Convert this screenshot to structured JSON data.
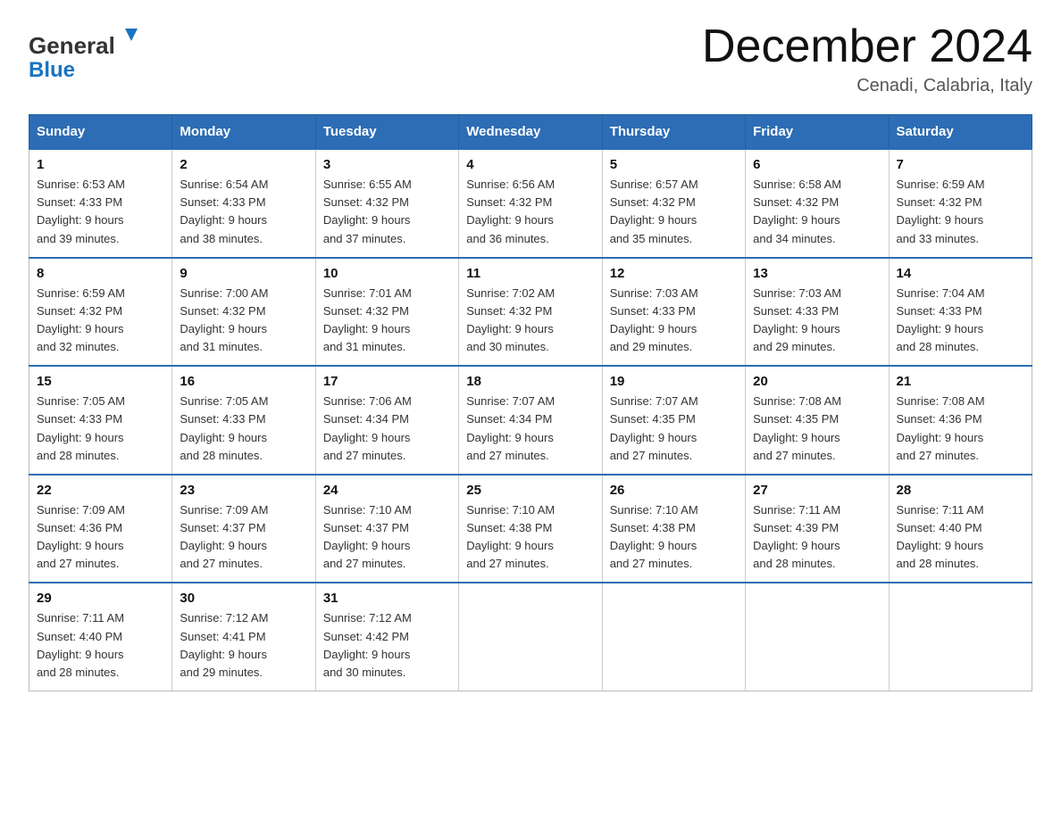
{
  "header": {
    "logo_general": "General",
    "logo_blue": "Blue",
    "month_title": "December 2024",
    "location": "Cenadi, Calabria, Italy"
  },
  "days_of_week": [
    "Sunday",
    "Monday",
    "Tuesday",
    "Wednesday",
    "Thursday",
    "Friday",
    "Saturday"
  ],
  "weeks": [
    [
      {
        "day": "1",
        "sunrise": "6:53 AM",
        "sunset": "4:33 PM",
        "daylight": "9 hours and 39 minutes."
      },
      {
        "day": "2",
        "sunrise": "6:54 AM",
        "sunset": "4:33 PM",
        "daylight": "9 hours and 38 minutes."
      },
      {
        "day": "3",
        "sunrise": "6:55 AM",
        "sunset": "4:32 PM",
        "daylight": "9 hours and 37 minutes."
      },
      {
        "day": "4",
        "sunrise": "6:56 AM",
        "sunset": "4:32 PM",
        "daylight": "9 hours and 36 minutes."
      },
      {
        "day": "5",
        "sunrise": "6:57 AM",
        "sunset": "4:32 PM",
        "daylight": "9 hours and 35 minutes."
      },
      {
        "day": "6",
        "sunrise": "6:58 AM",
        "sunset": "4:32 PM",
        "daylight": "9 hours and 34 minutes."
      },
      {
        "day": "7",
        "sunrise": "6:59 AM",
        "sunset": "4:32 PM",
        "daylight": "9 hours and 33 minutes."
      }
    ],
    [
      {
        "day": "8",
        "sunrise": "6:59 AM",
        "sunset": "4:32 PM",
        "daylight": "9 hours and 32 minutes."
      },
      {
        "day": "9",
        "sunrise": "7:00 AM",
        "sunset": "4:32 PM",
        "daylight": "9 hours and 31 minutes."
      },
      {
        "day": "10",
        "sunrise": "7:01 AM",
        "sunset": "4:32 PM",
        "daylight": "9 hours and 31 minutes."
      },
      {
        "day": "11",
        "sunrise": "7:02 AM",
        "sunset": "4:32 PM",
        "daylight": "9 hours and 30 minutes."
      },
      {
        "day": "12",
        "sunrise": "7:03 AM",
        "sunset": "4:33 PM",
        "daylight": "9 hours and 29 minutes."
      },
      {
        "day": "13",
        "sunrise": "7:03 AM",
        "sunset": "4:33 PM",
        "daylight": "9 hours and 29 minutes."
      },
      {
        "day": "14",
        "sunrise": "7:04 AM",
        "sunset": "4:33 PM",
        "daylight": "9 hours and 28 minutes."
      }
    ],
    [
      {
        "day": "15",
        "sunrise": "7:05 AM",
        "sunset": "4:33 PM",
        "daylight": "9 hours and 28 minutes."
      },
      {
        "day": "16",
        "sunrise": "7:05 AM",
        "sunset": "4:33 PM",
        "daylight": "9 hours and 28 minutes."
      },
      {
        "day": "17",
        "sunrise": "7:06 AM",
        "sunset": "4:34 PM",
        "daylight": "9 hours and 27 minutes."
      },
      {
        "day": "18",
        "sunrise": "7:07 AM",
        "sunset": "4:34 PM",
        "daylight": "9 hours and 27 minutes."
      },
      {
        "day": "19",
        "sunrise": "7:07 AM",
        "sunset": "4:35 PM",
        "daylight": "9 hours and 27 minutes."
      },
      {
        "day": "20",
        "sunrise": "7:08 AM",
        "sunset": "4:35 PM",
        "daylight": "9 hours and 27 minutes."
      },
      {
        "day": "21",
        "sunrise": "7:08 AM",
        "sunset": "4:36 PM",
        "daylight": "9 hours and 27 minutes."
      }
    ],
    [
      {
        "day": "22",
        "sunrise": "7:09 AM",
        "sunset": "4:36 PM",
        "daylight": "9 hours and 27 minutes."
      },
      {
        "day": "23",
        "sunrise": "7:09 AM",
        "sunset": "4:37 PM",
        "daylight": "9 hours and 27 minutes."
      },
      {
        "day": "24",
        "sunrise": "7:10 AM",
        "sunset": "4:37 PM",
        "daylight": "9 hours and 27 minutes."
      },
      {
        "day": "25",
        "sunrise": "7:10 AM",
        "sunset": "4:38 PM",
        "daylight": "9 hours and 27 minutes."
      },
      {
        "day": "26",
        "sunrise": "7:10 AM",
        "sunset": "4:38 PM",
        "daylight": "9 hours and 27 minutes."
      },
      {
        "day": "27",
        "sunrise": "7:11 AM",
        "sunset": "4:39 PM",
        "daylight": "9 hours and 28 minutes."
      },
      {
        "day": "28",
        "sunrise": "7:11 AM",
        "sunset": "4:40 PM",
        "daylight": "9 hours and 28 minutes."
      }
    ],
    [
      {
        "day": "29",
        "sunrise": "7:11 AM",
        "sunset": "4:40 PM",
        "daylight": "9 hours and 28 minutes."
      },
      {
        "day": "30",
        "sunrise": "7:12 AM",
        "sunset": "4:41 PM",
        "daylight": "9 hours and 29 minutes."
      },
      {
        "day": "31",
        "sunrise": "7:12 AM",
        "sunset": "4:42 PM",
        "daylight": "9 hours and 30 minutes."
      },
      null,
      null,
      null,
      null
    ]
  ],
  "labels": {
    "sunrise": "Sunrise:",
    "sunset": "Sunset:",
    "daylight": "Daylight:"
  }
}
